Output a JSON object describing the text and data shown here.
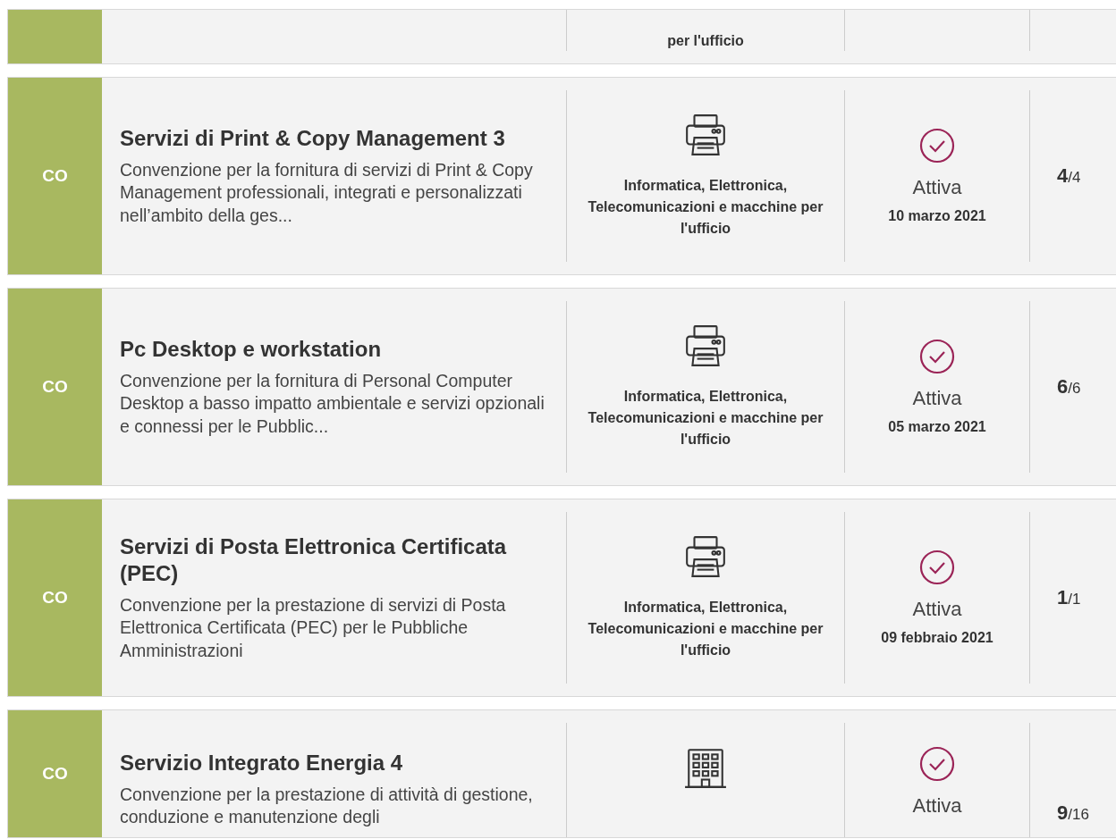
{
  "cards": [
    {
      "partial": true,
      "category": "per l'ufficio"
    },
    {
      "code": "CO",
      "title": "Servizi di Print & Copy Management 3",
      "description": "Convenzione per la fornitura di servizi di Print & Copy Management professionali, integrati e personalizzati nell’ambito della ges...",
      "kind": "printer",
      "category": "Informatica, Elettronica, Telecomunicazioni e macchine per l'ufficio",
      "status": "Attiva",
      "date": "10 marzo 2021",
      "count": "4",
      "of": "/4"
    },
    {
      "code": "CO",
      "title": "Pc Desktop e workstation",
      "description": "Convenzione per la fornitura di Personal Computer Desktop a basso impatto ambientale e servizi opzionali e connessi per le Pubblic...",
      "kind": "printer",
      "category": "Informatica, Elettronica, Telecomunicazioni e macchine per l'ufficio",
      "status": "Attiva",
      "date": "05 marzo 2021",
      "count": "6",
      "of": "/6"
    },
    {
      "code": "CO",
      "title": "Servizi di Posta Elettronica Certificata (PEC)",
      "description": "Convenzione per la prestazione di servizi di Posta Elettronica Certificata (PEC) per le Pubbliche Amministrazioni",
      "kind": "printer",
      "category": "Informatica, Elettronica, Telecomunicazioni e macchine per l'ufficio",
      "status": "Attiva",
      "date": "09 febbraio 2021",
      "count": "1",
      "of": "/1"
    },
    {
      "code": "CO",
      "title": "Servizio Integrato Energia 4",
      "description": "Convenzione per la prestazione di attività di gestione, conduzione e manutenzione degli",
      "kind": "building",
      "status": "Attiva",
      "count": "9",
      "of": "/16"
    }
  ]
}
